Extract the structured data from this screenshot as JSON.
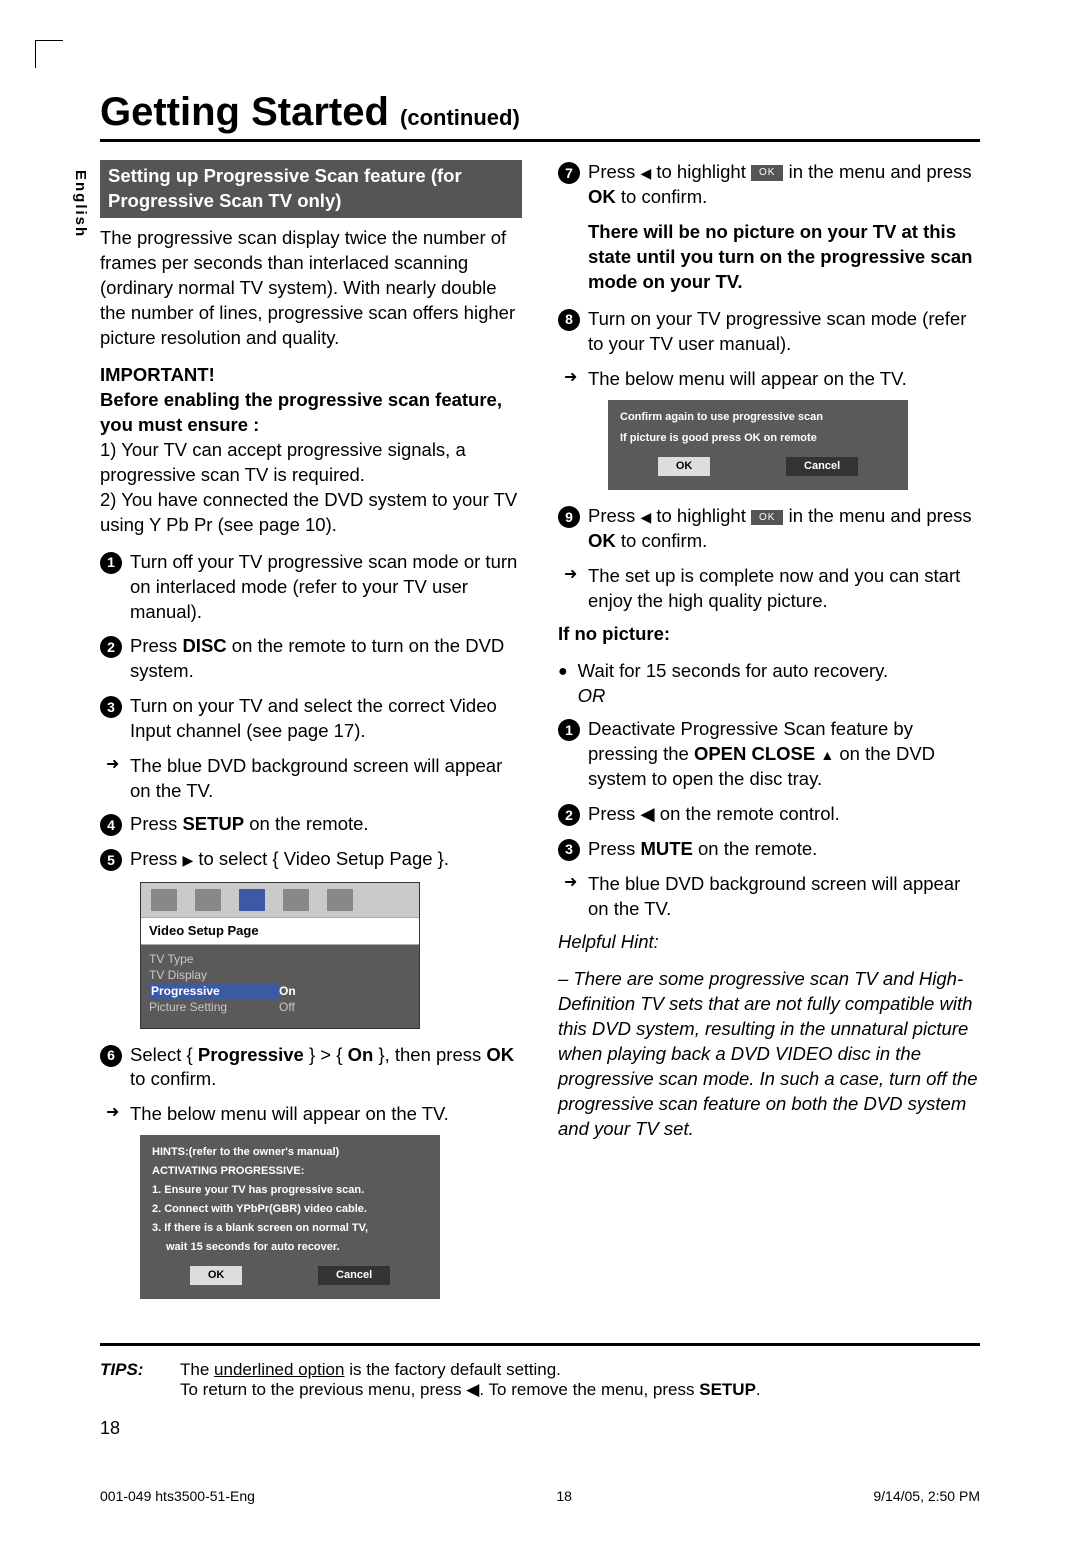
{
  "title_main": "Getting Started",
  "title_cont": "(continued)",
  "language_tab": "English",
  "section_head": "Setting up Progressive Scan feature (for Progressive Scan TV only)",
  "intro_para": "The progressive scan display twice the number of frames per seconds than interlaced scanning (ordinary normal TV system). With nearly double the number of lines, progressive scan offers higher picture resolution and quality.",
  "important_label": "IMPORTANT!",
  "important_line": "Before enabling the progressive scan feature, you must ensure :",
  "ensure_1": "1) Your TV can accept progressive signals, a progressive scan TV is required.",
  "ensure_2": "2) You have connected the DVD system to your TV using Y Pb Pr (see page 10).",
  "step1": "Turn off your TV progressive scan mode or turn on interlaced mode (refer to your TV user manual).",
  "step2_a": "Press ",
  "step2_b": "DISC",
  "step2_c": " on the remote to turn on the DVD system.",
  "step3": "Turn on your TV and select the correct Video Input channel (see page 17).",
  "step3_arrow": "The blue DVD background screen will appear on the TV.",
  "step4_a": "Press ",
  "step4_b": "SETUP",
  "step4_c": " on the remote.",
  "step5_a": "Press ",
  "step5_b": " to select { Video Setup Page }.",
  "vs_title": "Video Setup Page",
  "vs_rows": [
    {
      "label": "TV Type",
      "value": ""
    },
    {
      "label": "TV Display",
      "value": ""
    },
    {
      "label": "Progressive",
      "value": "On"
    },
    {
      "label": "Picture Setting",
      "value": "Off"
    }
  ],
  "step6_a": "Select { ",
  "step6_b": "Progressive",
  "step6_c": " } > { ",
  "step6_d": "On",
  "step6_e": " }, then press ",
  "step6_f": "OK",
  "step6_g": " to confirm.",
  "step6_arrow": "The below menu will appear on the TV.",
  "dlg1": {
    "hint": "HINTS:(refer to the owner's manual)",
    "act": "ACTIVATING PROGRESSIVE:",
    "l1": "1. Ensure your TV has progressive scan.",
    "l2": "2. Connect with YPbPr(GBR) video cable.",
    "l3": "3. If there is a blank screen on normal TV,",
    "l3b": "wait 15 seconds for auto recover.",
    "ok": "OK",
    "cancel": "Cancel"
  },
  "step7_a": "Press ",
  "step7_b": " to highlight ",
  "step7_c": " in the menu and press ",
  "step7_d": "OK",
  "step7_e": " to confirm.",
  "warn": "There will be no picture on your TV at this state until you turn on the progressive scan mode on your TV.",
  "step8": "Turn on your TV progressive scan mode (refer to your TV user manual).",
  "step8_arrow": "The below menu will appear on the TV.",
  "dlg2": {
    "l1": "Confirm again to use progressive scan",
    "l2": "If picture is good press OK on remote",
    "ok": "OK",
    "cancel": "Cancel"
  },
  "step9_a": "Press ",
  "step9_b": " to highlight ",
  "step9_c": " in the menu and press ",
  "step9_d": "OK",
  "step9_e": " to confirm.",
  "step9_arrow": "The set up is complete now and you can start enjoy the high quality picture.",
  "ifno_head": "If no picture:",
  "ifno_wait": "Wait for 15 seconds for auto recovery.",
  "ifno_or": "OR",
  "ifno_1a": "Deactivate Progressive Scan feature by pressing the ",
  "ifno_1b": "OPEN CLOSE",
  "ifno_1c": " on the DVD system to open the disc tray.",
  "ifno_2": "Press ◀ on the remote control.",
  "ifno_3a": "Press ",
  "ifno_3b": "MUTE",
  "ifno_3c": " on the remote.",
  "ifno_3_arrow": "The blue DVD background screen will appear on the TV.",
  "hint_head": "Helpful Hint:",
  "hint_body": "– There are some progressive scan TV and High-Definition TV sets that are not fully compatible with this DVD system, resulting in the unnatural picture when playing back a DVD VIDEO disc in the progressive scan mode. In such a case, turn off the progressive scan feature on both the DVD system and your TV set.",
  "tips_label": "TIPS:",
  "tips_l1a": "The ",
  "tips_l1b": "underlined option",
  "tips_l1c": " is the factory default setting.",
  "tips_l2": "To return to the previous menu, press ◀. To remove the menu, press ",
  "tips_l2b": "SETUP",
  "page_number": "18",
  "footer_left": "001-049 hts3500-51-Eng",
  "footer_mid": "18",
  "footer_right": "9/14/05, 2:50 PM"
}
